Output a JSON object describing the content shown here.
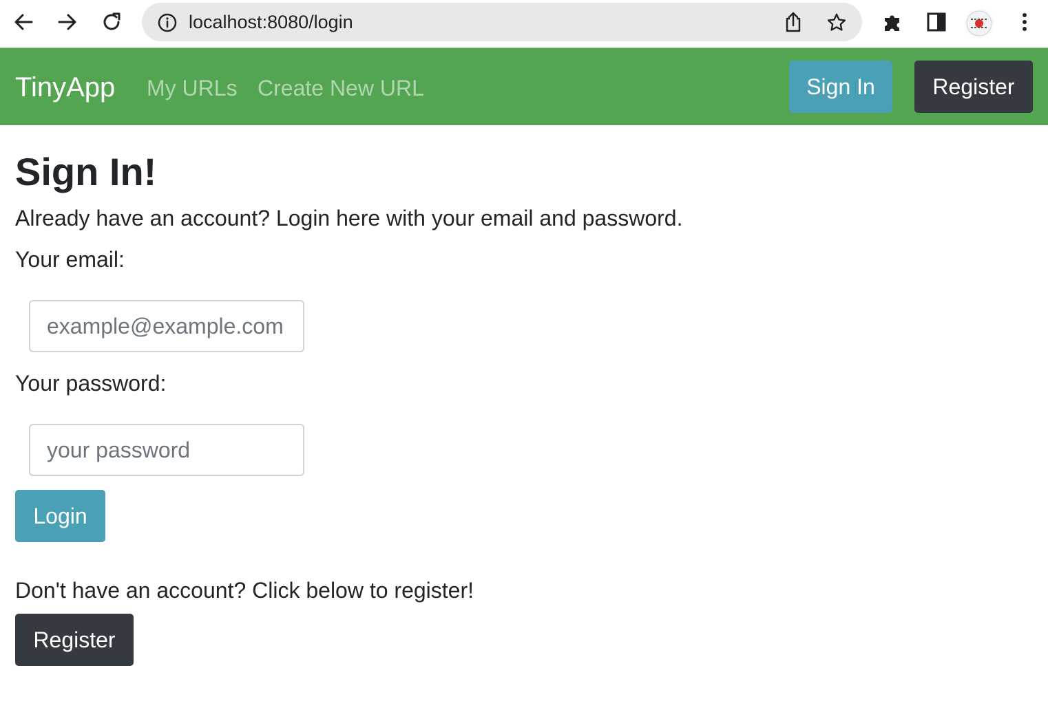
{
  "browser": {
    "url": "localhost:8080/login",
    "icons": [
      "back-arrow-icon",
      "forward-arrow-icon",
      "reload-icon",
      "info-icon",
      "share-icon",
      "star-icon",
      "puzzle-icon",
      "side-panel-icon",
      "profile-avatar",
      "kebab-menu-icon"
    ]
  },
  "navbar": {
    "brand": "TinyApp",
    "links": [
      "My URLs",
      "Create New URL"
    ],
    "sign_in_label": "Sign In",
    "register_label": "Register",
    "color": "#54a551"
  },
  "login": {
    "title": "Sign In!",
    "lead": "Already have an account? Login here with your email and password.",
    "email_label": "Your email:",
    "email_placeholder": "example@example.com",
    "password_label": "Your password:",
    "password_placeholder": "your password",
    "login_button": "Login",
    "no_account_text": "Don't have an account? Click below to register!",
    "register_button": "Register"
  },
  "colors": {
    "info_button": "#4aa0b5",
    "dark_button": "#343a40"
  }
}
